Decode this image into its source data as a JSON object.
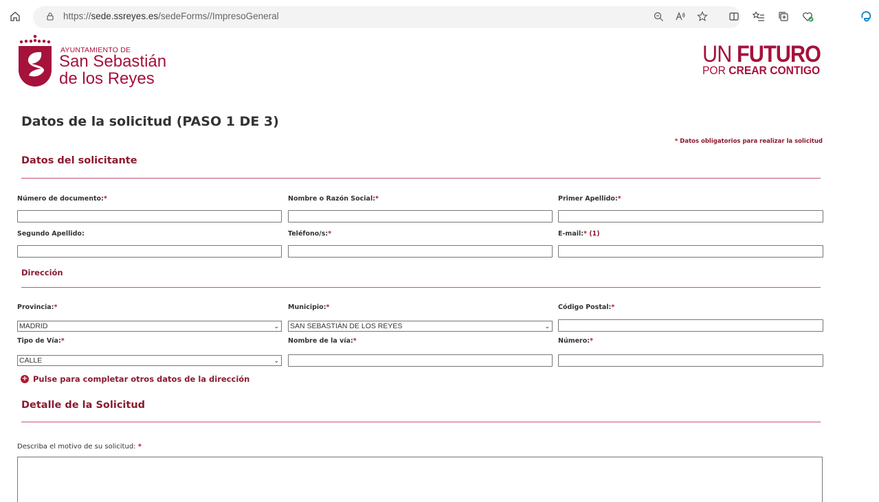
{
  "browser": {
    "url_prefix": "https://",
    "url_host": "sede.ssreyes.es",
    "url_path": "/sedeForms//ImpresoGeneral"
  },
  "header": {
    "ayto_small": "AYUNTAMIENTO DE",
    "ayto_line1": "San Sebastián",
    "ayto_line2": "de los Reyes",
    "slogan_un": "UN ",
    "slogan_futuro": "FUTURO",
    "slogan_por": "POR ",
    "slogan_crear": "CREAR CONTIGO",
    "brand_color": "#a5123b"
  },
  "page": {
    "title": "Datos de la solicitud (PASO 1 DE 3)",
    "required_note": "* Datos obligatorios para realizar la solicitud"
  },
  "solicitante": {
    "title": "Datos del solicitante",
    "numero_documento": "Número de documento:",
    "nombre": "Nombre o Razón Social:",
    "primer_apellido": "Primer Apellido:",
    "segundo_apellido": "Segundo Apellido:",
    "telefono": "Teléfono/s:",
    "email": "E-mail:",
    "email_note": " (1)",
    "req_mark": "*"
  },
  "direccion": {
    "title": "Dirección",
    "provincia": "Provincia:",
    "provincia_value": "MADRID",
    "municipio": "Municipio:",
    "municipio_value": "SAN SEBASTIÁN DE LOS REYES",
    "codigo_postal": "Código Postal:",
    "tipo_via": "Tipo de Vía:",
    "tipo_via_value": "CALLE",
    "nombre_via": "Nombre de la vía:",
    "numero": "Número:",
    "otros_datos_link": "Pulse para completar otros datos de la dirección"
  },
  "detalle": {
    "title": "Detalle de la Solicitud",
    "motivo_label": "Describa el motivo de su solicitud:",
    "req_mark": "*"
  }
}
